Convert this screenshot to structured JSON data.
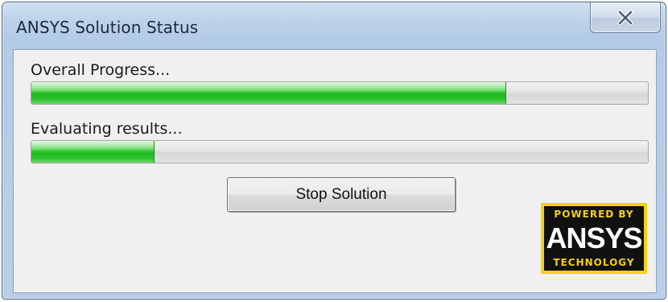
{
  "window": {
    "title": "ANSYS Solution Status"
  },
  "overall": {
    "label": "Overall Progress...",
    "progress": 0.77
  },
  "current": {
    "label": "Evaluating results...",
    "progress": 0.2
  },
  "buttons": {
    "stop_label": "Stop Solution"
  },
  "logo": {
    "top_text": "POWERED BY",
    "brand_text": "ANSYS",
    "bottom_text": "TECHNOLOGY"
  },
  "icons": {
    "close": "close-icon"
  },
  "colors": {
    "progress_green": "#1eb81e",
    "logo_yellow": "#f5cf12",
    "title_bar": "#b9cfe7"
  }
}
